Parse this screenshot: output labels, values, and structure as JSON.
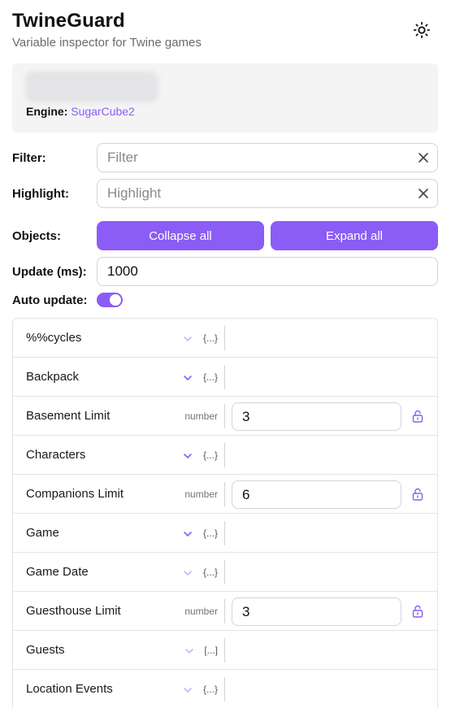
{
  "header": {
    "title": "TwineGuard",
    "subtitle": "Variable inspector for Twine games",
    "theme_icon": "sun-icon"
  },
  "info": {
    "engine_label": "Engine:",
    "engine_value": "SugarCube2"
  },
  "filter": {
    "label": "Filter:",
    "placeholder": "Filter",
    "value": ""
  },
  "highlight": {
    "label": "Highlight:",
    "placeholder": "Highlight",
    "value": ""
  },
  "objects": {
    "label": "Objects:",
    "collapse_label": "Collapse all",
    "expand_label": "Expand all"
  },
  "update": {
    "label": "Update (ms):",
    "value": "1000"
  },
  "auto_update": {
    "label": "Auto update:",
    "enabled": true
  },
  "colors": {
    "accent": "#8b5cf6",
    "chevron_dim": "#c4b5fd",
    "border": "#e4e4e7"
  },
  "variables": [
    {
      "name": "%%cycles",
      "kind": "object",
      "badge": "{...}",
      "chevron_active": false
    },
    {
      "name": "Backpack",
      "kind": "object",
      "badge": "{...}",
      "chevron_active": true
    },
    {
      "name": "Basement Limit",
      "kind": "number",
      "type": "number",
      "value": "3"
    },
    {
      "name": "Characters",
      "kind": "object",
      "badge": "{...}",
      "chevron_active": true
    },
    {
      "name": "Companions Limit",
      "kind": "number",
      "type": "number",
      "value": "6"
    },
    {
      "name": "Game",
      "kind": "object",
      "badge": "{...}",
      "chevron_active": true
    },
    {
      "name": "Game Date",
      "kind": "object",
      "badge": "{...}",
      "chevron_active": false
    },
    {
      "name": "Guesthouse Limit",
      "kind": "number",
      "type": "number",
      "value": "3"
    },
    {
      "name": "Guests",
      "kind": "array",
      "badge": "[...]",
      "chevron_active": false
    },
    {
      "name": "Location Events",
      "kind": "object",
      "badge": "{...}",
      "chevron_active": false
    }
  ]
}
